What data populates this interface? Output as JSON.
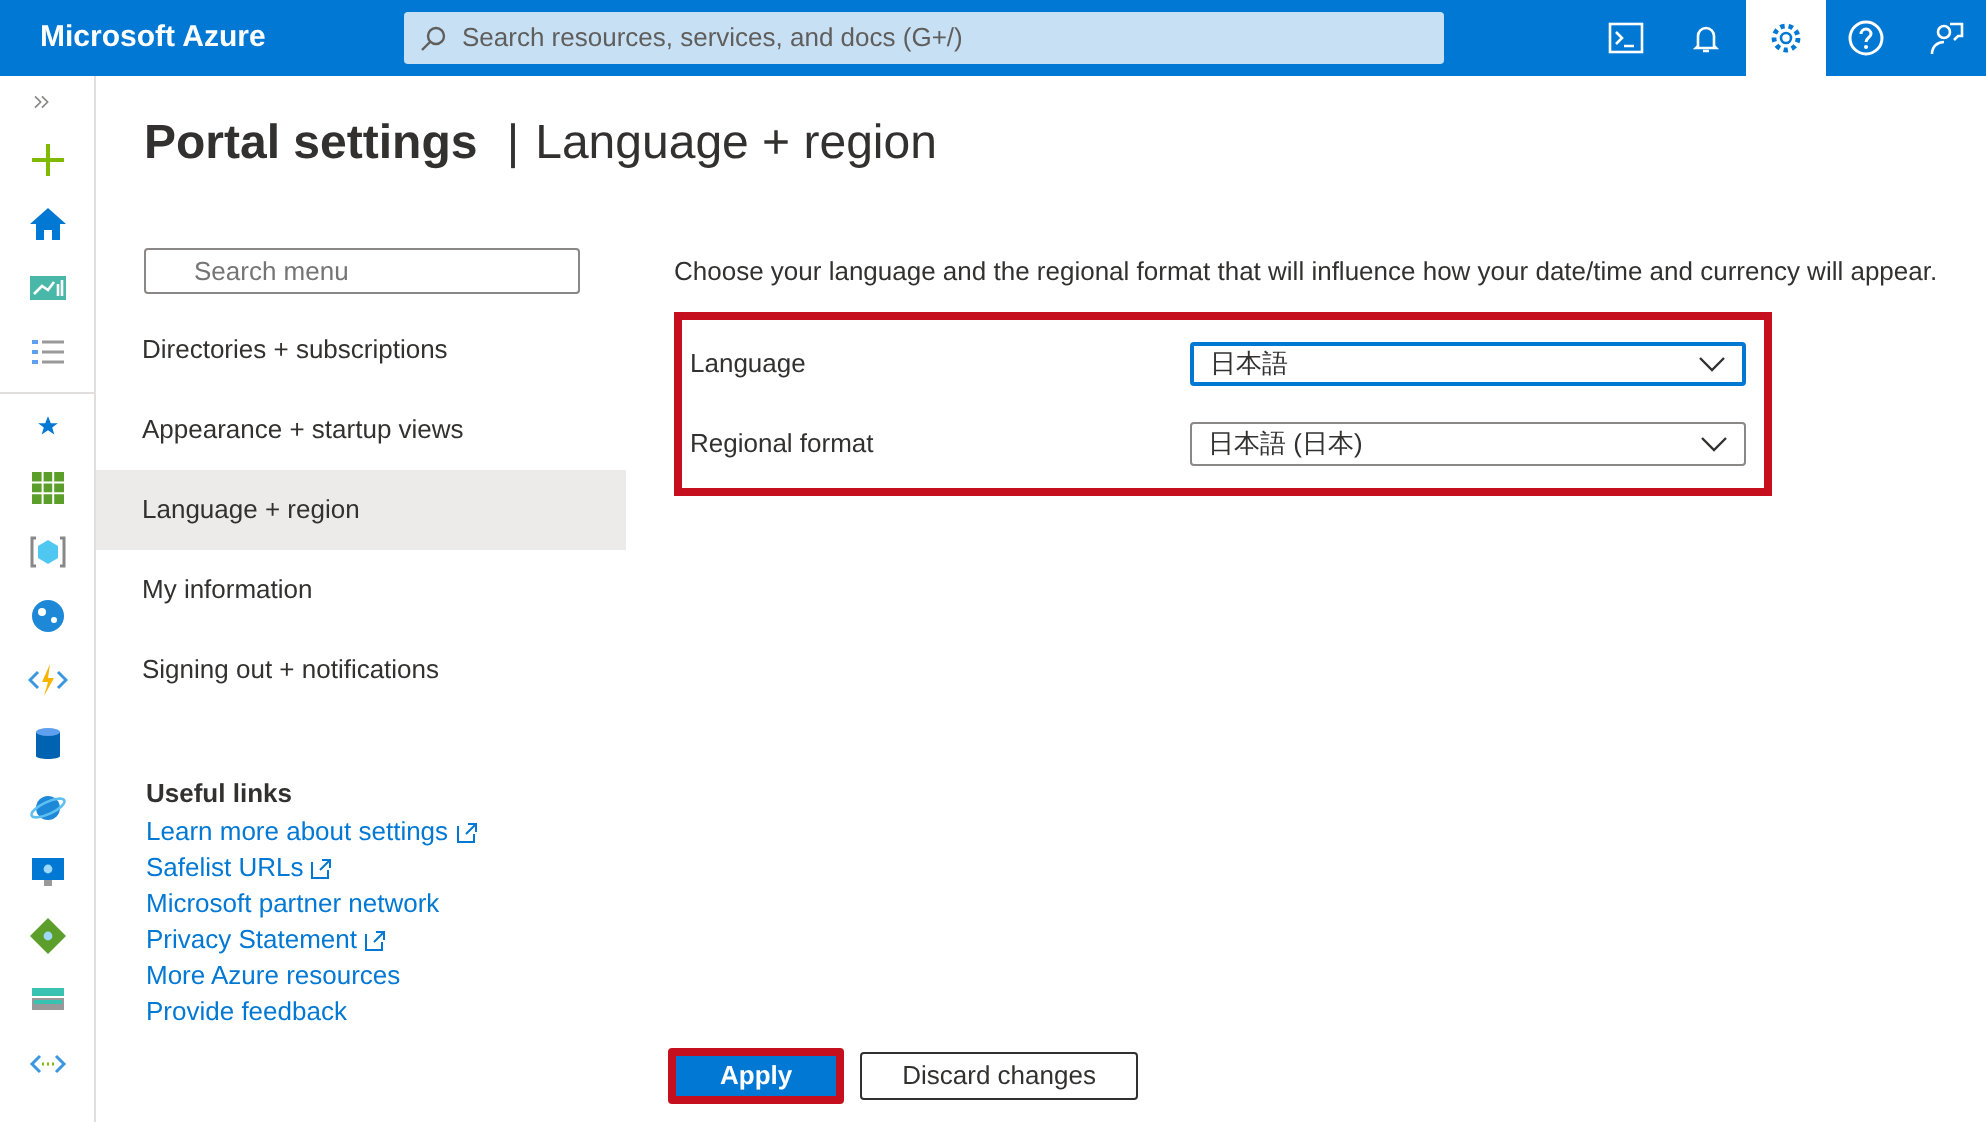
{
  "topbar": {
    "brand": "Microsoft Azure",
    "search": {
      "placeholder": "Search resources, services, and docs (G+/)"
    },
    "actions": [
      {
        "kind": "terminal",
        "selected": false
      },
      {
        "kind": "bell",
        "selected": false
      },
      {
        "kind": "gear",
        "selected": true
      },
      {
        "kind": "help",
        "selected": false
      },
      {
        "kind": "feedback",
        "selected": false
      }
    ]
  },
  "page_title": {
    "main": "Portal settings",
    "separator": "|",
    "sub": "Language + region"
  },
  "menu": {
    "search": {
      "placeholder": "Search menu"
    },
    "items": [
      {
        "label": "Directories + subscriptions",
        "selected": false
      },
      {
        "label": "Appearance + startup views",
        "selected": false
      },
      {
        "label": "Language + region",
        "selected": true
      },
      {
        "label": "My information",
        "selected": false
      },
      {
        "label": "Signing out + notifications",
        "selected": false
      }
    ]
  },
  "useful_links": {
    "heading": "Useful links",
    "links": [
      {
        "label": "Learn more about settings",
        "external": true
      },
      {
        "label": "Safelist URLs",
        "external": true
      },
      {
        "label": "Microsoft partner network",
        "external": false
      },
      {
        "label": "Privacy Statement",
        "external": true
      },
      {
        "label": "More Azure resources",
        "external": false
      },
      {
        "label": "Provide feedback",
        "external": false
      }
    ]
  },
  "description": "Choose your language and the regional format that will influence how your date/time and currency will appear.",
  "form": {
    "highlighted": true,
    "fields": [
      {
        "label": "Language",
        "value": "日本語",
        "focused": true
      },
      {
        "label": "Regional format",
        "value": "日本語 (日本)",
        "focused": false
      }
    ]
  },
  "buttons": [
    {
      "label": "Apply",
      "kind": "primary",
      "highlighted": true
    },
    {
      "label": "Discard changes",
      "kind": "secondary",
      "highlighted": false
    }
  ]
}
